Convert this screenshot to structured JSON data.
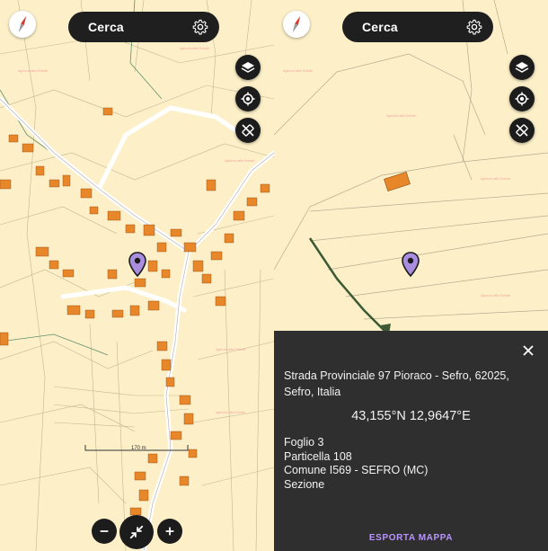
{
  "colors": {
    "map_background": "#fdf0c8",
    "building": "#e8862a",
    "road": "#ffffff",
    "parcel_line": "#b5a98f",
    "button_dark": "#1c1c1c",
    "panel_background": "#2f2f2f",
    "pin": "#a98ee0",
    "accent_link": "#b894ff"
  },
  "left_screen": {
    "search": {
      "label": "Cerca"
    },
    "scale_label": "170 m",
    "icons": [
      "compass-icon",
      "gear-icon",
      "layers-icon",
      "my-location-icon",
      "ruler-off-icon",
      "zoom-out-icon",
      "collapse-icon",
      "zoom-in-icon",
      "map-pin-icon"
    ]
  },
  "right_screen": {
    "search": {
      "label": "Cerca"
    },
    "info": {
      "address": "Strada Provinciale 97 Pioraco - Sefro, 62025, Sefro, Italia",
      "coordinates": "43,155°N 12,9647°E",
      "foglio": "Foglio 3",
      "particella": "Particella 108",
      "comune": "Comune I569 - SEFRO (MC)",
      "sezione": "Sezione",
      "export_label": "ESPORTA MAPPA"
    }
  }
}
